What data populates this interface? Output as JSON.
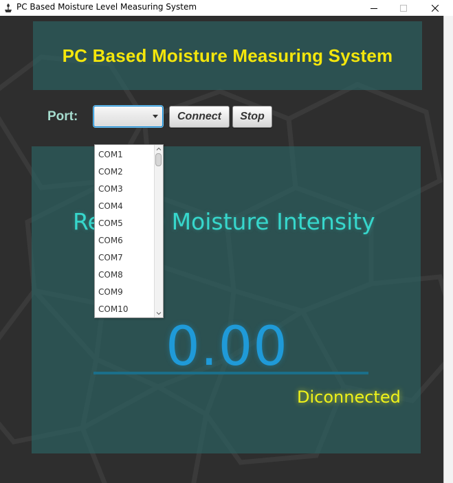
{
  "window": {
    "title": "PC Based Moisture Level Measuring System",
    "app_icon": "plant-pot-icon",
    "controls": [
      "minimize-icon",
      "maximize-icon",
      "close-icon"
    ]
  },
  "header": {
    "title": "PC Based Moisture Measuring System"
  },
  "port": {
    "label": "Port:",
    "selected": "",
    "options": [
      "COM1",
      "COM2",
      "COM3",
      "COM4",
      "COM5",
      "COM6",
      "COM7",
      "COM8",
      "COM9",
      "COM10"
    ]
  },
  "buttons": {
    "connect": "Connect",
    "stop": "Stop"
  },
  "main": {
    "intensity_title": "Relative Moisture Intensity",
    "reading": "0.00",
    "status": "Diconnected"
  },
  "colors": {
    "background": "#2e2e2e",
    "panel": "#2d5f5f",
    "title_yellow": "#f4e60c",
    "label_teal": "#a6ddcf",
    "intensity_cyan": "#37d7cc",
    "reading_blue": "#1f9ad8",
    "status_yellow": "#eff21a"
  }
}
